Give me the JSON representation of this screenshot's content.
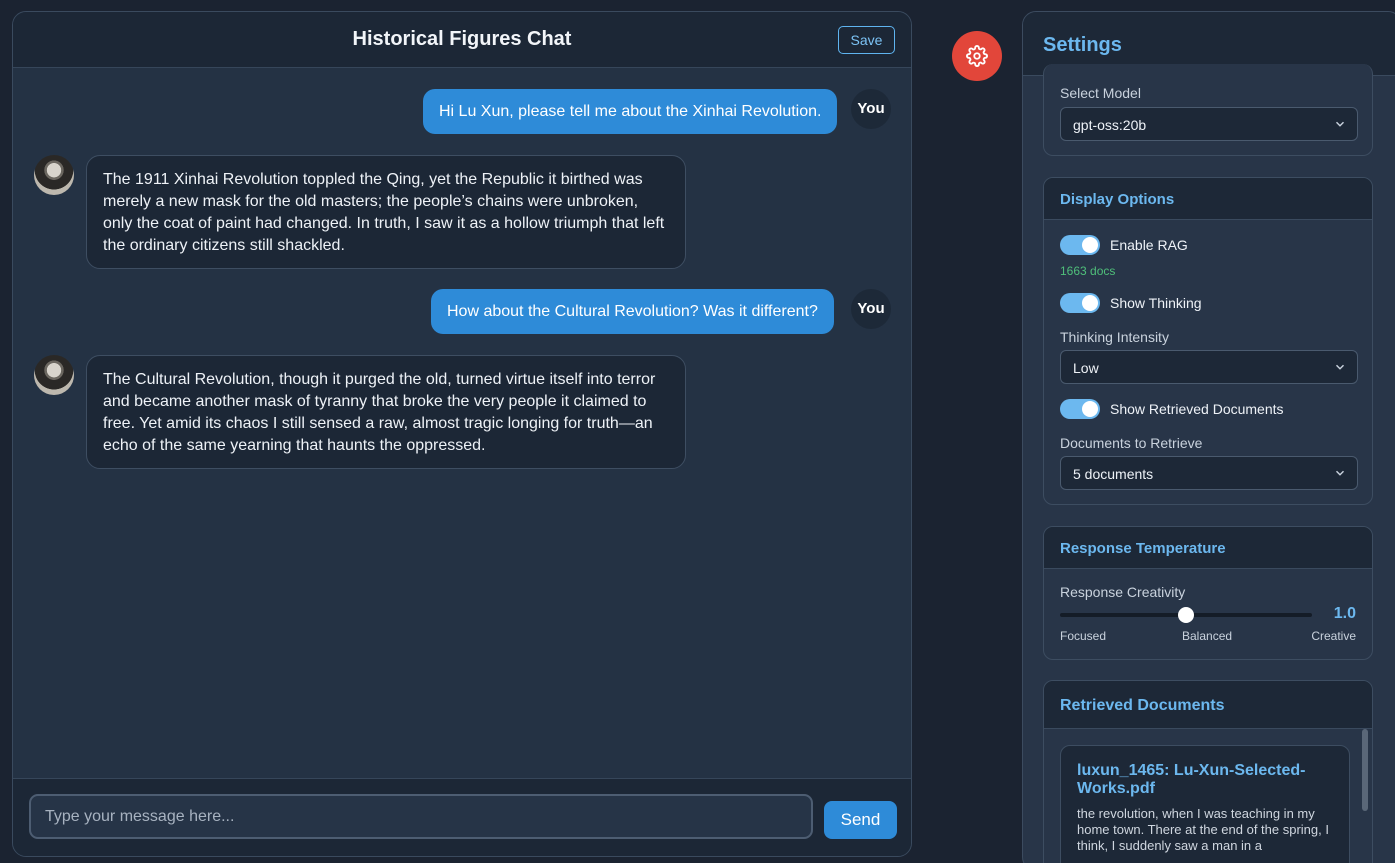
{
  "chat": {
    "title": "Historical Figures Chat",
    "save_label": "Save",
    "messages": [
      {
        "role": "user",
        "text": "Hi Lu Xun, please tell me about the Xinhai Revolution.",
        "badge": "You"
      },
      {
        "role": "assistant",
        "text": "The 1911 Xinhai Revolution toppled the Qing, yet the Republic it birthed was merely a new mask for the old masters; the people’s chains were unbroken, only the coat of paint had changed. In truth, I saw it as a hollow triumph that left the ordinary citizens still shackled."
      },
      {
        "role": "user",
        "text": "How about the Cultural Revolution? Was it different?",
        "badge": "You"
      },
      {
        "role": "assistant",
        "text": "The Cultural Revolution, though it purged the old, turned virtue itself into terror and became another mask of tyranny that broke the very people it claimed to free. Yet amid its chaos I still sensed a raw, almost tragic longing for truth—an echo of the same yearning that haunts the oppressed."
      }
    ],
    "input_placeholder": "Type your message here...",
    "send_label": "Send"
  },
  "gear_icon": "gear-icon",
  "settings": {
    "title": "Settings",
    "model": {
      "label": "Select Model",
      "value": "gpt-oss:20b"
    },
    "display": {
      "title": "Display Options",
      "enable_rag": {
        "label": "Enable RAG",
        "on": true
      },
      "docs_count": "1663 docs",
      "show_thinking": {
        "label": "Show Thinking",
        "on": true
      },
      "thinking_intensity": {
        "label": "Thinking Intensity",
        "value": "Low"
      },
      "show_retrieved": {
        "label": "Show Retrieved Documents",
        "on": true
      },
      "docs_to_retrieve": {
        "label": "Documents to Retrieve",
        "value": "5 documents"
      }
    },
    "temperature": {
      "title": "Response Temperature",
      "label": "Response Creativity",
      "value": "1.0",
      "level": 0.5,
      "low_label": "Focused",
      "mid_label": "Balanced",
      "high_label": "Creative"
    },
    "retrieved": {
      "title": "Retrieved Documents",
      "doc_title": "luxun_1465: Lu-Xun-Selected-Works.pdf",
      "doc_excerpt": "the revolution, when I was teaching in my home town. There at the end of the spring, I think, I suddenly saw a man in a"
    }
  }
}
